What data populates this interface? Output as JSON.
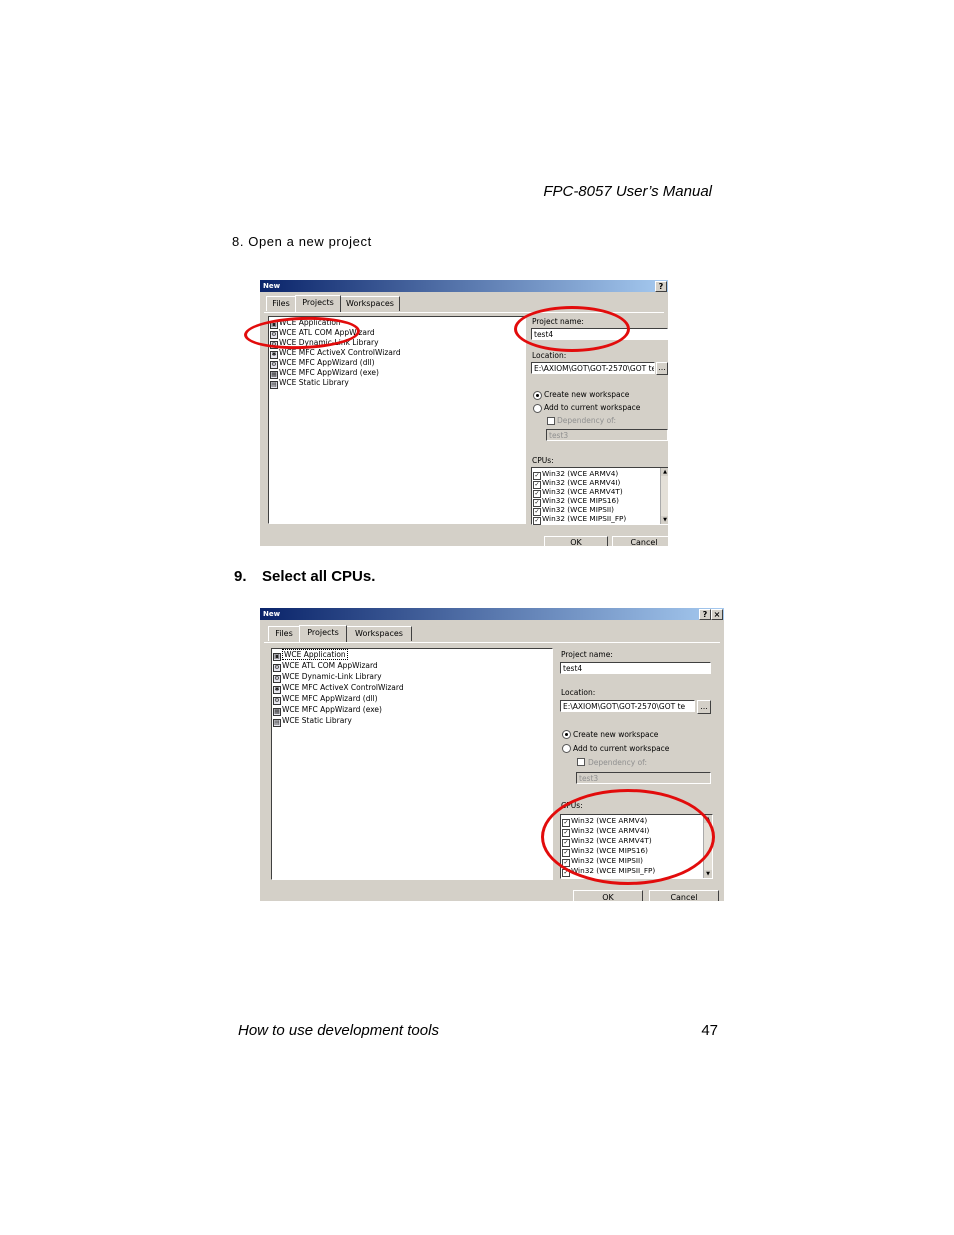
{
  "header": {
    "title": "FPC-8057 User’s Manual"
  },
  "step8": {
    "text": "8. Open a new project"
  },
  "step9": {
    "number": "9.",
    "text": "Select all CPUs."
  },
  "footer": {
    "left": "How to use development tools",
    "page": "47"
  },
  "dialog": {
    "title": "New",
    "help_glyph": "?",
    "close_glyph": "×",
    "tabs": [
      "Files",
      "Projects",
      "Workspaces"
    ],
    "project_types": [
      "WCE Application",
      "WCE ATL COM AppWizard",
      "WCE Dynamic-Link Library",
      "WCE MFC ActiveX ControlWizard",
      "WCE MFC AppWizard (dll)",
      "WCE MFC AppWizard (exe)",
      "WCE Static Library"
    ],
    "project_name_label": "Project name:",
    "project_name_value": "test4",
    "location_label": "Location:",
    "location_value": "E:\\AXIOM\\GOT\\GOT-2570\\GOT te",
    "browse_label": "...",
    "create_ws_label": "Create new workspace",
    "add_ws_label": "Add to current workspace",
    "dependency_label": "Dependency of:",
    "dependency_value": "test3",
    "cpus_label": "CPUs:",
    "cpus": [
      "Win32 (WCE ARMV4)",
      "Win32 (WCE ARMV4I)",
      "Win32 (WCE ARMV4T)",
      "Win32 (WCE MIPS16)",
      "Win32 (WCE MIPSII)",
      "Win32 (WCE MIPSII_FP)"
    ],
    "ok_label": "OK",
    "cancel_label": "Cancel",
    "check_glyph": "✓",
    "highlight_color": "#e20c0c"
  }
}
